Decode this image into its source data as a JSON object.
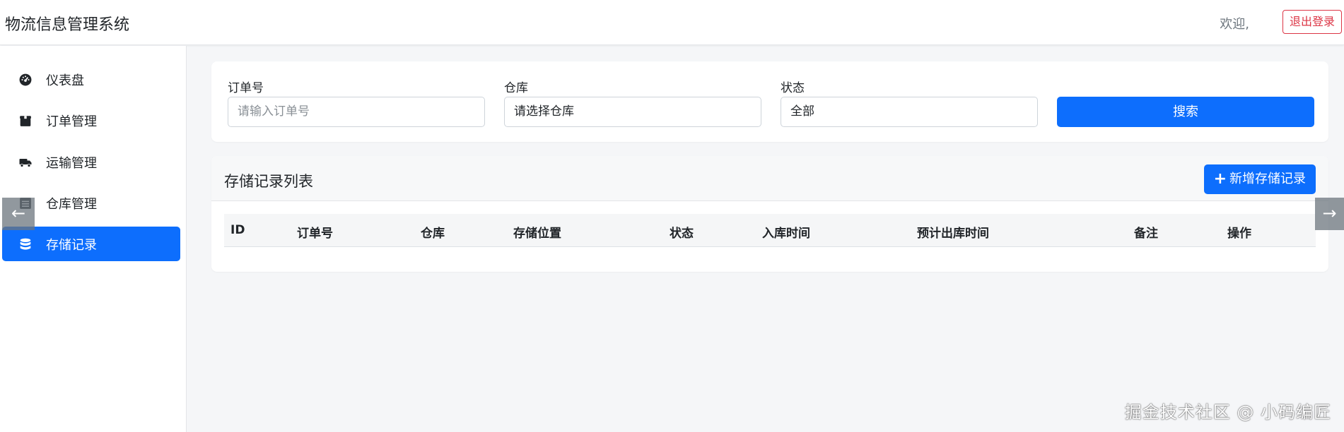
{
  "header": {
    "brand": "物流信息管理系统",
    "welcome": "欢迎,",
    "logout_label": "退出登录"
  },
  "sidebar": {
    "items": [
      {
        "label": "仪表盘",
        "icon": "dashboard-icon"
      },
      {
        "label": "订单管理",
        "icon": "box-icon"
      },
      {
        "label": "运输管理",
        "icon": "truck-icon"
      },
      {
        "label": "仓库管理",
        "icon": "warehouse-icon"
      },
      {
        "label": "存储记录",
        "icon": "database-icon",
        "active": true
      }
    ]
  },
  "filters": {
    "order_label": "订单号",
    "order_placeholder": "请输入订单号",
    "warehouse_label": "仓库",
    "warehouse_value": "请选择仓库",
    "status_label": "状态",
    "status_value": "全部",
    "search_label": "搜索"
  },
  "list": {
    "title": "存储记录列表",
    "add_label": "新增存储记录",
    "columns": [
      "ID",
      "订单号",
      "仓库",
      "存储位置",
      "状态",
      "入库时间",
      "预计出库时间",
      "备注",
      "操作"
    ]
  },
  "nav_arrows": {
    "prev": "←",
    "next": "→"
  },
  "watermark": "掘金技术社区 @ 小码编匠",
  "colors": {
    "primary": "#0d6efd",
    "danger": "#dc3545"
  }
}
